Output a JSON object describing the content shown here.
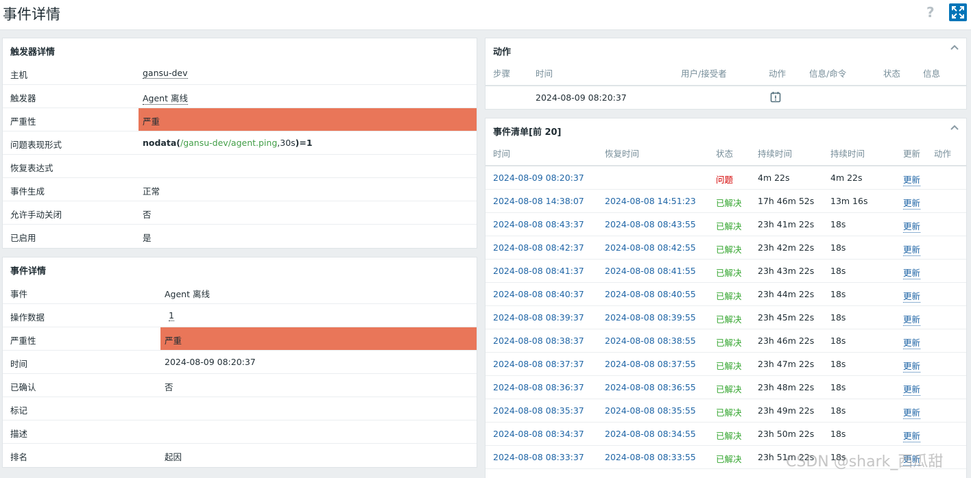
{
  "page": {
    "title": "事件详情",
    "help": "?"
  },
  "trigger_details": {
    "title": "触发器详情",
    "rows": [
      {
        "label": "主机",
        "value": "gansu-dev"
      },
      {
        "label": "触发器",
        "value": "Agent 离线"
      },
      {
        "label": "严重性",
        "value": "严重"
      },
      {
        "label": "问题表现形式",
        "expr_prefix": "nodata(",
        "expr_item": "/gansu-dev/agent.ping",
        "expr_sep": ",30s",
        "expr_suffix": ")=1"
      },
      {
        "label": "恢复表达式",
        "value": ""
      },
      {
        "label": "事件生成",
        "value": "正常"
      },
      {
        "label": "允许手动关闭",
        "value": "否"
      },
      {
        "label": "已启用",
        "value": "是"
      }
    ]
  },
  "event_details": {
    "title": "事件详情",
    "rows": [
      {
        "label": "事件",
        "value": "Agent 离线"
      },
      {
        "label": "操作数据",
        "value": "1"
      },
      {
        "label": "严重性",
        "value": "严重"
      },
      {
        "label": "时间",
        "value": "2024-08-09 08:20:37"
      },
      {
        "label": "已确认",
        "value": "否"
      },
      {
        "label": "标记",
        "value": ""
      },
      {
        "label": "描述",
        "value": ""
      },
      {
        "label": "排名",
        "value": "起因"
      }
    ]
  },
  "actions": {
    "title": "动作",
    "columns": [
      "步骤",
      "时间",
      "用户/接受者",
      "动作",
      "信息/命令",
      "状态",
      "信息"
    ],
    "rows": [
      {
        "time": "2024-08-09 08:20:37",
        "action_icon": "calendar-alert-icon"
      }
    ]
  },
  "event_list": {
    "title": "事件清单[前 20]",
    "columns": [
      "时间",
      "恢复时间",
      "状态",
      "持续时间",
      "持续时间",
      "更新",
      "动作"
    ],
    "rows": [
      {
        "time": "2024-08-09 08:20:37",
        "recovery": "",
        "status": "问题",
        "duration": "4m 22s",
        "duration2": "4m 22s",
        "update": "更新"
      },
      {
        "time": "2024-08-08 14:38:07",
        "recovery": "2024-08-08 14:51:23",
        "status": "已解决",
        "duration": "17h 46m 52s",
        "duration2": "13m 16s",
        "update": "更新"
      },
      {
        "time": "2024-08-08 08:43:37",
        "recovery": "2024-08-08 08:43:55",
        "status": "已解决",
        "duration": "23h 41m 22s",
        "duration2": "18s",
        "update": "更新"
      },
      {
        "time": "2024-08-08 08:42:37",
        "recovery": "2024-08-08 08:42:55",
        "status": "已解决",
        "duration": "23h 42m 22s",
        "duration2": "18s",
        "update": "更新"
      },
      {
        "time": "2024-08-08 08:41:37",
        "recovery": "2024-08-08 08:41:55",
        "status": "已解决",
        "duration": "23h 43m 22s",
        "duration2": "18s",
        "update": "更新"
      },
      {
        "time": "2024-08-08 08:40:37",
        "recovery": "2024-08-08 08:40:55",
        "status": "已解决",
        "duration": "23h 44m 22s",
        "duration2": "18s",
        "update": "更新"
      },
      {
        "time": "2024-08-08 08:39:37",
        "recovery": "2024-08-08 08:39:55",
        "status": "已解决",
        "duration": "23h 45m 22s",
        "duration2": "18s",
        "update": "更新"
      },
      {
        "time": "2024-08-08 08:38:37",
        "recovery": "2024-08-08 08:38:55",
        "status": "已解决",
        "duration": "23h 46m 22s",
        "duration2": "18s",
        "update": "更新"
      },
      {
        "time": "2024-08-08 08:37:37",
        "recovery": "2024-08-08 08:37:55",
        "status": "已解决",
        "duration": "23h 47m 22s",
        "duration2": "18s",
        "update": "更新"
      },
      {
        "time": "2024-08-08 08:36:37",
        "recovery": "2024-08-08 08:36:55",
        "status": "已解决",
        "duration": "23h 48m 22s",
        "duration2": "18s",
        "update": "更新"
      },
      {
        "time": "2024-08-08 08:35:37",
        "recovery": "2024-08-08 08:35:55",
        "status": "已解决",
        "duration": "23h 49m 22s",
        "duration2": "18s",
        "update": "更新"
      },
      {
        "time": "2024-08-08 08:34:37",
        "recovery": "2024-08-08 08:34:55",
        "status": "已解决",
        "duration": "23h 50m 22s",
        "duration2": "18s",
        "update": "更新"
      },
      {
        "time": "2024-08-08 08:33:37",
        "recovery": "2024-08-08 08:33:55",
        "status": "已解决",
        "duration": "23h 51m 22s",
        "duration2": "18s",
        "update": "更新"
      }
    ]
  },
  "colors": {
    "severity_high": "#e97659",
    "link": "#1f65a6",
    "problem": "#d40000",
    "resolved": "#35a630"
  },
  "watermark": "CSDN @shark_西瓜甜"
}
